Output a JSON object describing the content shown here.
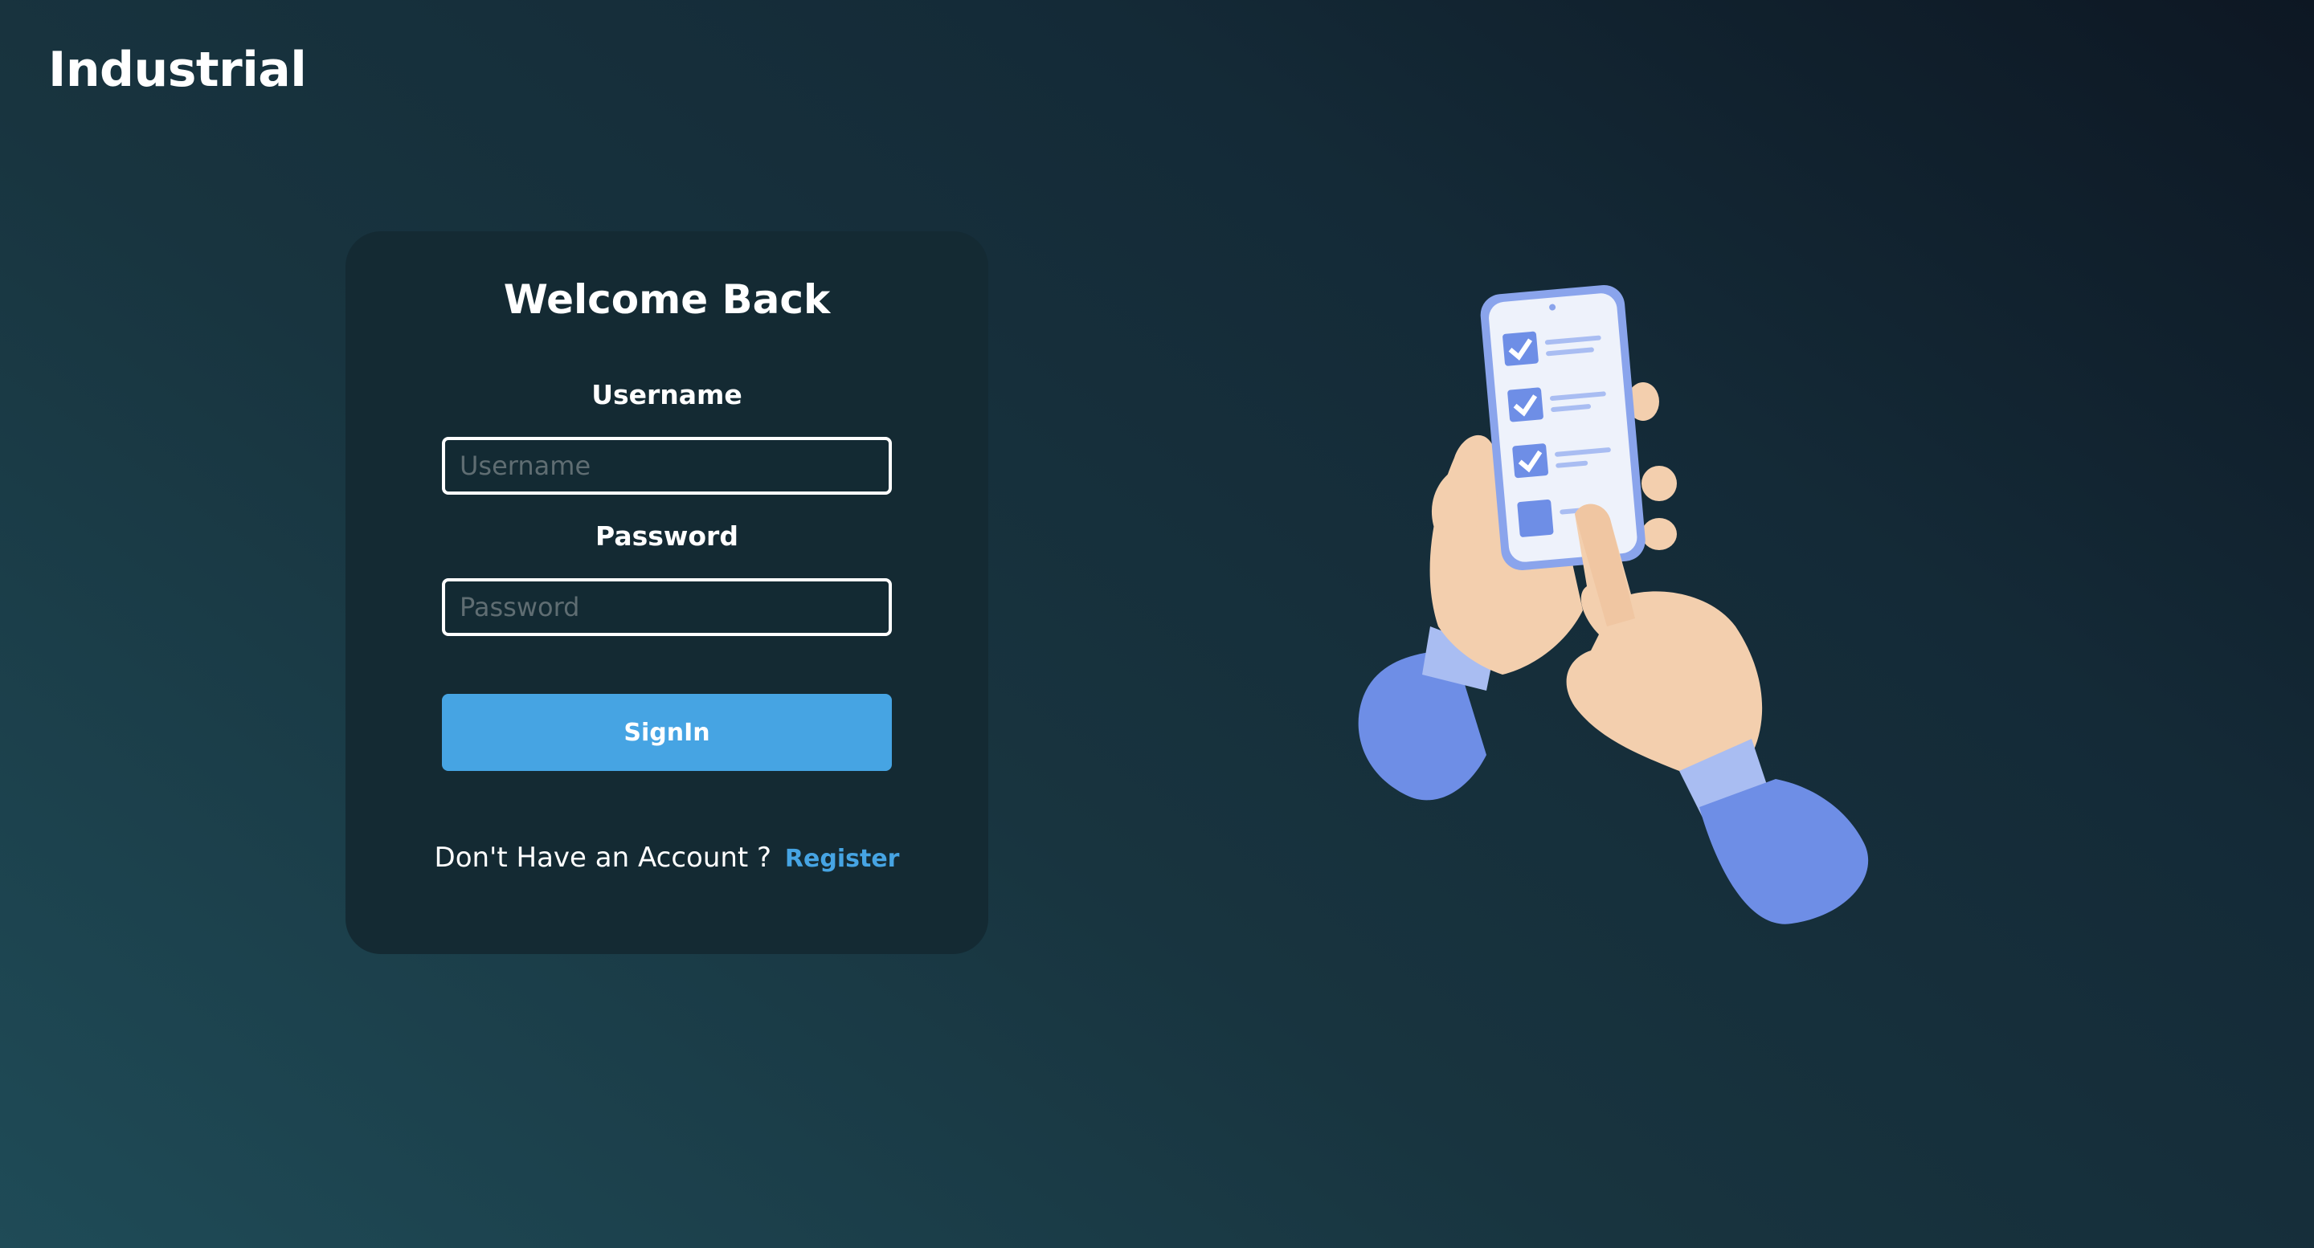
{
  "brand": {
    "name": "Industrial"
  },
  "login_card": {
    "title": "Welcome Back",
    "username_label": "Username",
    "username_placeholder": "Username",
    "username_value": "",
    "password_label": "Password",
    "password_placeholder": "Password",
    "password_value": "",
    "signin_label": "SignIn",
    "register_prompt": "Don't Have an Account ?",
    "register_link": "Register"
  },
  "illustration": {
    "icon": "hand-holding-phone-checklist-icon",
    "checklist_checked": 3,
    "checklist_total": 4
  },
  "colors": {
    "accent": "#46a4e3",
    "card_background": "#142a33",
    "illustration_blue": "#6e8ee6",
    "skin": "#f3cfae"
  }
}
